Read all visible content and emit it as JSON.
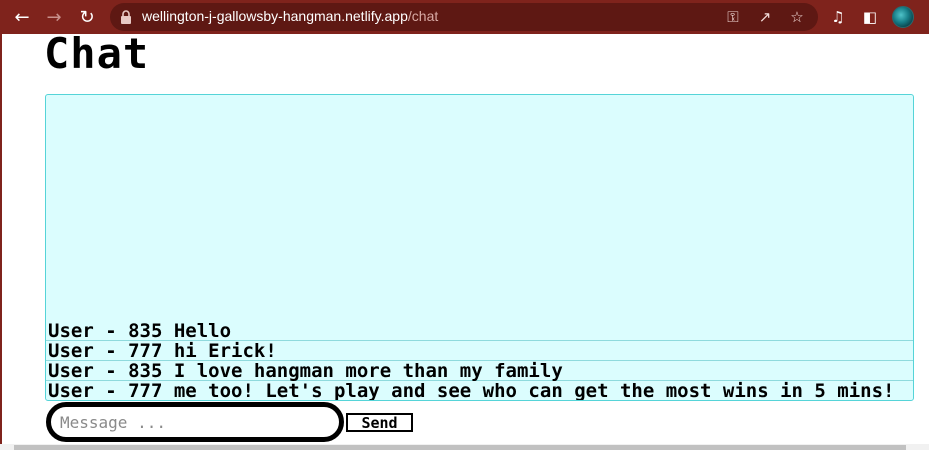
{
  "browser": {
    "url_host": "wellington-j-gallowsby-hangman.netlify.app",
    "url_path": "/chat",
    "icons": [
      "back-arrow-icon",
      "forward-arrow-icon",
      "reload-icon",
      "lock-icon",
      "key-icon",
      "share-icon",
      "star-icon",
      "media-icon",
      "sidebar-icon",
      "profile-avatar"
    ],
    "toolbar_color": "#7f231c"
  },
  "page": {
    "title": "Chat",
    "messages": [
      {
        "text": "User - 835 Hello"
      },
      {
        "text": "User - 777 hi Erick!"
      },
      {
        "text": "User - 835 I love hangman more than my family"
      },
      {
        "text": "User - 777 me too! Let's play and see who can get the most wins in 5 mins!"
      }
    ],
    "input_placeholder": "Message ...",
    "send_label": "Send",
    "chat_bg": "#dbfdfe",
    "chat_border": "#55d4d8"
  }
}
